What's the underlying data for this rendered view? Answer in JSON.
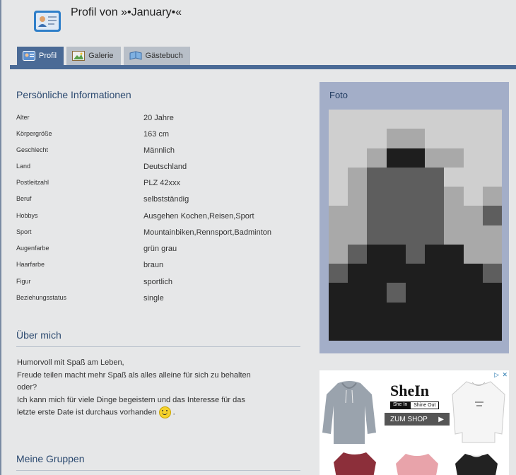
{
  "header": {
    "title": "Profil von »•January•«"
  },
  "tabs": [
    {
      "label": "Profil",
      "icon": "profile-icon",
      "active": true
    },
    {
      "label": "Galerie",
      "icon": "gallery-icon",
      "active": false
    },
    {
      "label": "Gästebuch",
      "icon": "guestbook-icon",
      "active": false
    }
  ],
  "personal": {
    "title": "Persönliche Informationen",
    "rows": [
      {
        "label": "Alter",
        "value": "20 Jahre"
      },
      {
        "label": "Körpergröße",
        "value": "163 cm"
      },
      {
        "label": "Geschlecht",
        "value": "Männlich"
      },
      {
        "label": "Land",
        "value": "Deutschland"
      },
      {
        "label": "Postleitzahl",
        "value": "PLZ 42xxx"
      },
      {
        "label": "Beruf",
        "value": "selbstständig"
      },
      {
        "label": "Hobbys",
        "value": "Ausgehen Kochen,Reisen,Sport"
      },
      {
        "label": "Sport",
        "value": "Mountainbiken,Rennsport,Badminton"
      },
      {
        "label": "Augenfarbe",
        "value": "grün grau"
      },
      {
        "label": "Haarfarbe",
        "value": "braun"
      },
      {
        "label": "Figur",
        "value": "sportlich"
      },
      {
        "label": "Beziehungsstatus",
        "value": "single"
      }
    ]
  },
  "about": {
    "title": "Über mich",
    "lines": [
      "Humorvoll mit Spaß am Leben,",
      "Freude teilen macht mehr Spaß als alles alleine für sich zu behalten",
      "oder?",
      "Ich kann mich für viele Dinge begeistern und das Interesse für das",
      "letzte erste Date ist durchaus vorhanden"
    ],
    "line_end": " ."
  },
  "groups": {
    "title": "Meine Gruppen"
  },
  "photo": {
    "title": "Foto"
  },
  "ad": {
    "brand": "SheIn",
    "sub_left": "She In",
    "sub_right": "Shine Out",
    "cta": "ZUM SHOP",
    "choices_icon": "ad-choices-icon",
    "close_icon": "close-icon"
  },
  "colors": {
    "tab_active": "#4a6a96",
    "photo_panel": "#a3aec8",
    "heading": "#2c4a70"
  }
}
